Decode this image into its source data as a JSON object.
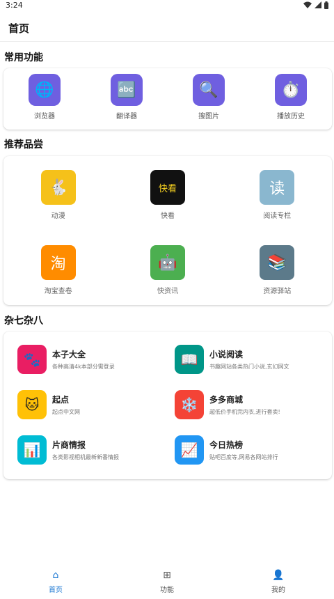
{
  "status_bar": {
    "time": "3:24",
    "wifi_icon": "wifi-icon",
    "signal_icon": "signal-icon",
    "battery_icon": "battery-icon"
  },
  "app_bar": {
    "title": "首页"
  },
  "sections": {
    "common": "常用功能",
    "recommend": "推荐品尝",
    "misc": "杂七杂八"
  },
  "common_functions": [
    {
      "label": "浏览器",
      "icon": "globe-icon",
      "glyph": "🌐"
    },
    {
      "label": "翻译器",
      "icon": "abc-icon",
      "glyph": "🔤"
    },
    {
      "label": "搜图片",
      "icon": "magnifier-icon",
      "glyph": "🔍"
    },
    {
      "label": "播放历史",
      "icon": "stopwatch-icon",
      "glyph": "⏱️"
    }
  ],
  "recommend": [
    {
      "label": "动漫",
      "icon": "anime-icon",
      "glyph": "🐇",
      "color": "#f5c11a"
    },
    {
      "label": "快看",
      "icon": "kuaikan-icon",
      "glyph": "快看",
      "color": "#111111"
    },
    {
      "label": "阅读专栏",
      "icon": "read-icon",
      "glyph": "读",
      "color": "#8ab7cf"
    },
    {
      "label": "淘宝查卷",
      "icon": "taobao-icon",
      "glyph": "淘",
      "color": "#ff8c00"
    },
    {
      "label": "快资讯",
      "icon": "robot-icon",
      "glyph": "🤖",
      "color": "#4caf50"
    },
    {
      "label": "资源驿站",
      "icon": "books-icon",
      "glyph": "📚",
      "color": "#5c7a8a"
    }
  ],
  "misc": [
    {
      "title": "本子大全",
      "desc": "各种高清4k本部分需登录",
      "icon": "paw-icon",
      "glyph": "🐾",
      "color": "#e91e63"
    },
    {
      "title": "小说阅读",
      "desc": "书趣网站各类热门小说,玄幻网文",
      "icon": "book-icon",
      "glyph": "📖",
      "color": "#009688"
    },
    {
      "title": "起点",
      "desc": "起点中文网",
      "icon": "cat-icon",
      "glyph": "🐱",
      "color": "#ffc107"
    },
    {
      "title": "多多商城",
      "desc": "超低价手机完内衣,进行套卖!",
      "icon": "snowflake-icon",
      "glyph": "❄️",
      "color": "#f44336"
    },
    {
      "title": "片商情报",
      "desc": "各类影视相机最新新番情报",
      "icon": "bar-chart-icon",
      "glyph": "📊",
      "color": "#00bcd4"
    },
    {
      "title": "今日热榜",
      "desc": "贴吧百度等,网易各网站排行",
      "icon": "line-chart-icon",
      "glyph": "📈",
      "color": "#2196f3"
    }
  ],
  "bottom_nav": [
    {
      "label": "首页",
      "icon": "home-icon",
      "glyph": "⌂",
      "active": true
    },
    {
      "label": "功能",
      "icon": "grid-icon",
      "glyph": "⊞",
      "active": false
    },
    {
      "label": "我的",
      "icon": "person-icon",
      "glyph": "👤",
      "active": false
    }
  ],
  "colors": {
    "accent": "#1976d2",
    "function_icon_bg": "#6f5fe0",
    "inactive_nav": "#555555"
  }
}
